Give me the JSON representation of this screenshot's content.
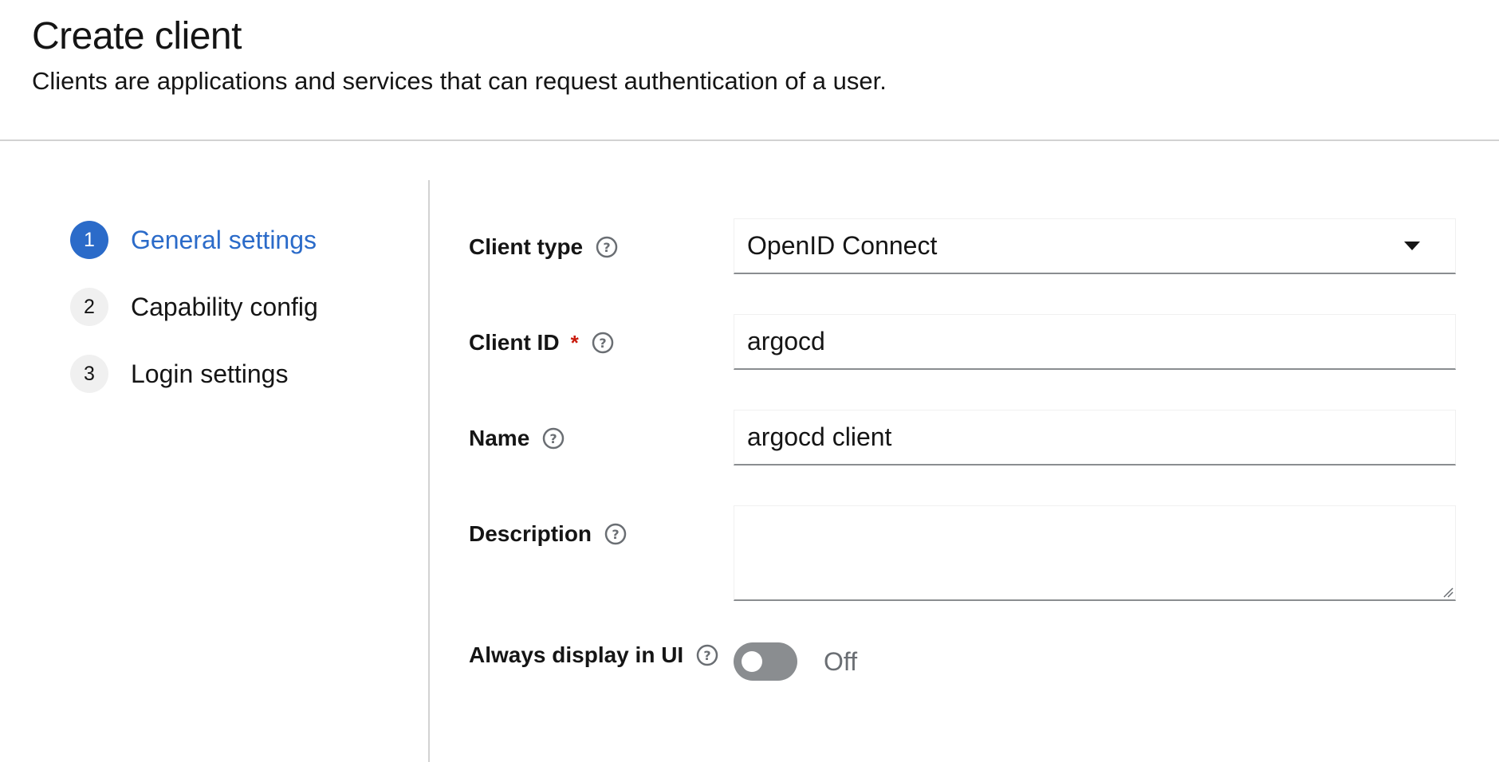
{
  "header": {
    "title": "Create client",
    "subtitle": "Clients are applications and services that can request authentication of a user."
  },
  "wizard": {
    "steps": [
      {
        "number": "1",
        "label": "General settings",
        "current": true
      },
      {
        "number": "2",
        "label": "Capability config",
        "current": false
      },
      {
        "number": "3",
        "label": "Login settings",
        "current": false
      }
    ]
  },
  "form": {
    "client_type": {
      "label": "Client type",
      "value": "OpenID Connect"
    },
    "client_id": {
      "label": "Client ID",
      "required_mark": "*",
      "value": "argocd"
    },
    "name": {
      "label": "Name",
      "value": "argocd client"
    },
    "description": {
      "label": "Description",
      "value": ""
    },
    "always_display": {
      "label": "Always display in UI",
      "state": "Off",
      "enabled": false
    }
  },
  "colors": {
    "accent": "#2b6bc9",
    "required": "#c9190b",
    "border": "#d2d2d2",
    "toggle_off": "#8a8d90"
  },
  "icons": {
    "help": "question-circle-icon",
    "dropdown": "caret-down-icon"
  }
}
